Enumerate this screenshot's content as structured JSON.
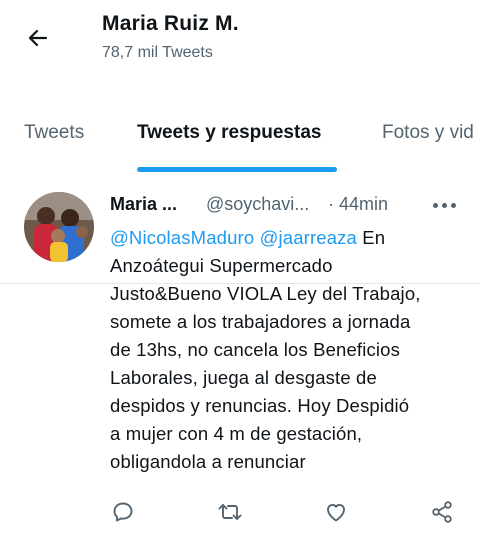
{
  "header": {
    "name": "Maria Ruiz M.",
    "tweet_count": "78,7 mil Tweets",
    "back_icon": "arrow-left-icon"
  },
  "tabs": [
    {
      "label": "Tweets",
      "active": false
    },
    {
      "label": "Tweets y respuestas",
      "active": true
    },
    {
      "label": "Fotos y vid",
      "active": false
    }
  ],
  "tweet": {
    "author_name": "Maria ...",
    "handle": "@soychavi...",
    "time": "· 44min",
    "mentions": [
      "@NicolasMaduro",
      "@jaarreaza"
    ],
    "first_line_rest": "En",
    "lines": [
      "Anzoátegui Supermercado",
      "Justo&Bueno VIOLA Ley del Trabajo,",
      "somete a los trabajadores a jornada",
      "de 13hs, no cancela los Beneficios",
      "Laborales, juega al desgaste de",
      "despidos y renuncias. Hoy Despidió",
      "a mujer con 4 m de gestación,",
      "obligandola a renunciar"
    ]
  },
  "actions": [
    {
      "icon": "reply-icon"
    },
    {
      "icon": "retweet-icon"
    },
    {
      "icon": "like-icon"
    },
    {
      "icon": "share-icon"
    }
  ],
  "colors": {
    "accent": "#1d9bf0",
    "text": "#0f1419",
    "secondary": "#536471"
  }
}
